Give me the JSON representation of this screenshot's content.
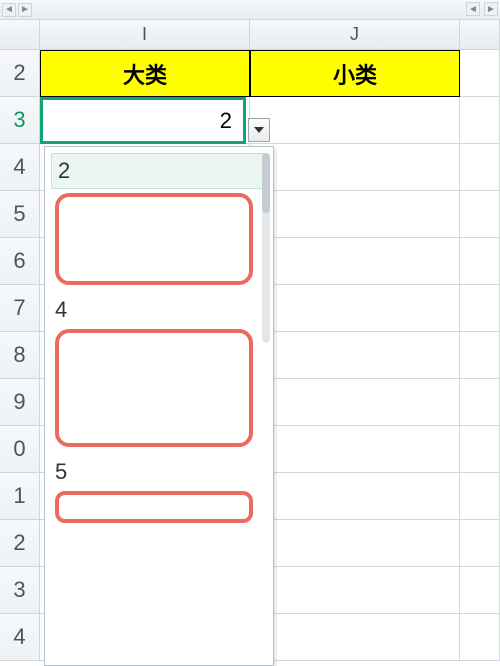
{
  "columns": {
    "I": "I",
    "J": "J"
  },
  "row_numbers": [
    "2",
    "3",
    "4",
    "5",
    "6",
    "7",
    "8",
    "9",
    "0",
    "1",
    "2",
    "3",
    "4"
  ],
  "headers": {
    "I": "大类",
    "J": "小类"
  },
  "active_cell": {
    "address": "I3",
    "value": "2"
  },
  "dropdown": {
    "open": true,
    "highlighted": "2",
    "items": [
      "2",
      "",
      "4",
      "",
      "5",
      ""
    ]
  },
  "annotations": {
    "red_boxes": 3
  }
}
